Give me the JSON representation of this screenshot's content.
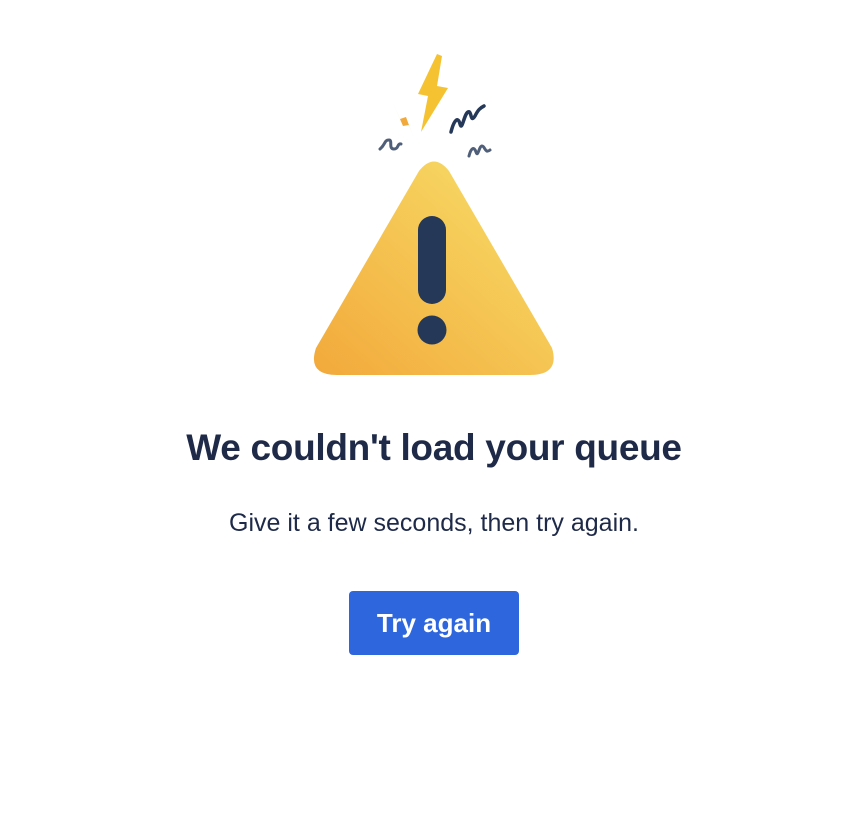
{
  "error": {
    "title": "We couldn't load your queue",
    "message": "Give it a few seconds, then try again.",
    "retry_label": "Try again",
    "illustration_icon": "warning-triangle-icon"
  },
  "colors": {
    "heading_text": "#1e2a48",
    "button_background": "#2d66dd",
    "button_text": "#ffffff",
    "triangle_light": "#f8db63",
    "triangle_dark": "#f2a93b",
    "exclamation": "#253858",
    "squiggle": "#505f79"
  }
}
